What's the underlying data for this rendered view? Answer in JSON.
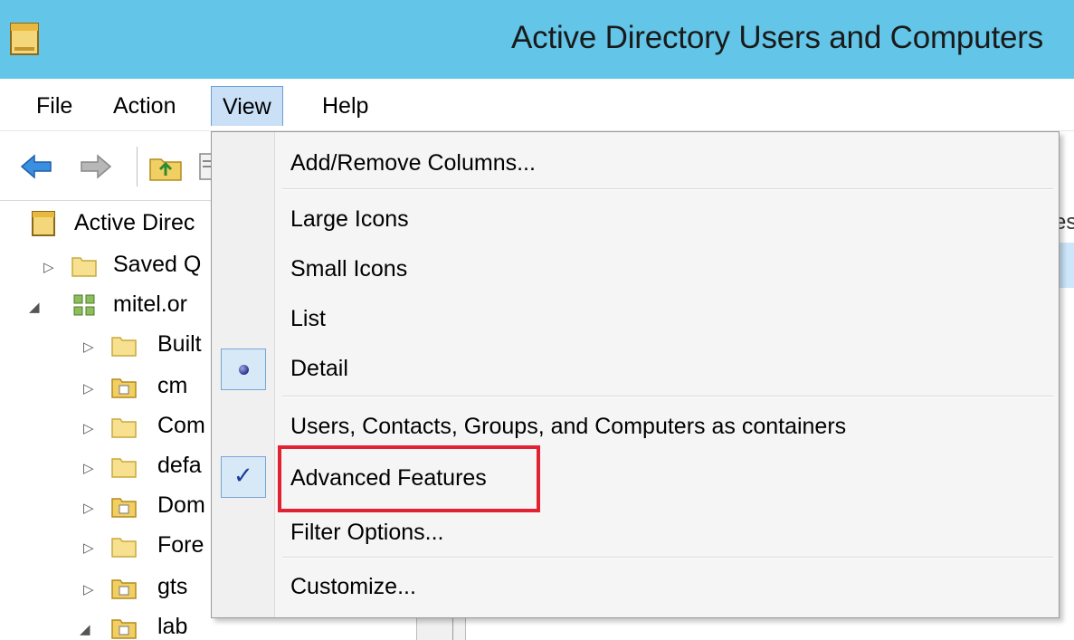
{
  "window": {
    "title": "Active Directory Users and Computers"
  },
  "menubar": {
    "items": [
      {
        "label": "File"
      },
      {
        "label": "Action"
      },
      {
        "label": "View"
      },
      {
        "label": "Help"
      }
    ]
  },
  "tree": {
    "root_label": "Active Direc",
    "items": [
      {
        "label": "Saved Q",
        "expander": "▷",
        "icon": "folder-icon"
      },
      {
        "label": "mitel.or",
        "expander": "◢",
        "icon": "domain-icon"
      },
      {
        "label": "Built",
        "expander": "▷",
        "icon": "folder-icon"
      },
      {
        "label": "cm",
        "expander": "▷",
        "icon": "ou-folder-icon"
      },
      {
        "label": "Com",
        "expander": "▷",
        "icon": "folder-icon"
      },
      {
        "label": "defa",
        "expander": "▷",
        "icon": "folder-icon"
      },
      {
        "label": "Dom",
        "expander": "▷",
        "icon": "ou-folder-icon"
      },
      {
        "label": "Fore",
        "expander": "▷",
        "icon": "folder-icon"
      },
      {
        "label": "gts",
        "expander": "▷",
        "icon": "ou-folder-icon"
      },
      {
        "label": "lab",
        "expander": "◢",
        "icon": "ou-folder-icon"
      }
    ]
  },
  "right_pane": {
    "column_fragment": "es"
  },
  "view_menu": {
    "items": [
      {
        "label": "Add/Remove Columns...",
        "state": "none"
      },
      {
        "label": "Large Icons",
        "state": "none"
      },
      {
        "label": "Small Icons",
        "state": "none"
      },
      {
        "label": "List",
        "state": "none"
      },
      {
        "label": "Detail",
        "state": "radio-selected"
      },
      {
        "label": "Users, Contacts, Groups, and Computers as containers",
        "state": "none"
      },
      {
        "label": "Advanced Features",
        "state": "checked",
        "highlighted": true
      },
      {
        "label": "Filter Options...",
        "state": "none"
      },
      {
        "label": "Customize...",
        "state": "none"
      }
    ],
    "check_glyph": "✓"
  },
  "colors": {
    "titlebar": "#63c6e8",
    "menu_active": "#c9e0f7",
    "highlight_box": "#e02233"
  }
}
